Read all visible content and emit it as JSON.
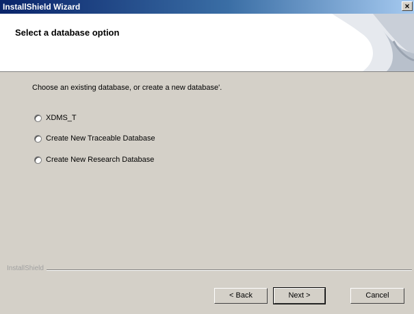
{
  "window": {
    "title": "InstallShield Wizard",
    "close_glyph": "×"
  },
  "header": {
    "title": "Select a database option",
    "graphic_icon": "page-curl-graphic"
  },
  "main": {
    "instruction": "Choose an existing database, or create a new database'.",
    "options": [
      {
        "label": "XDMS_T",
        "selected": false
      },
      {
        "label": "Create New Traceable Database",
        "selected": false
      },
      {
        "label": "Create New Research Database",
        "selected": false
      }
    ]
  },
  "footer": {
    "brand": "InstallShield",
    "back_label": "< Back",
    "next_label": "Next >",
    "cancel_label": "Cancel"
  }
}
